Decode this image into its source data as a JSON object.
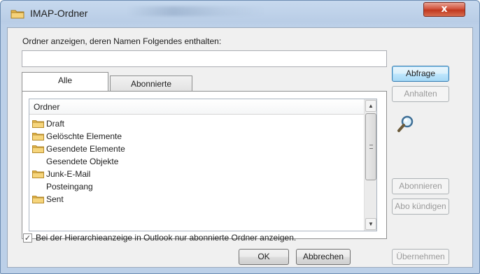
{
  "window": {
    "title": "IMAP-Ordner",
    "close_label": "x"
  },
  "filter": {
    "label": "Ordner anzeigen, deren Namen Folgendes enthalten:",
    "value": ""
  },
  "tabs": [
    {
      "label": "Alle",
      "active": true
    },
    {
      "label": "Abonnierte",
      "active": false
    }
  ],
  "folder_list": {
    "column_header": "Ordner",
    "rows": [
      {
        "name": "Draft",
        "icon": "folder-icon"
      },
      {
        "name": "Gelöschte Elemente",
        "icon": "folder-icon"
      },
      {
        "name": "Gesendete Elemente",
        "icon": "folder-icon"
      },
      {
        "name": "Gesendete Objekte",
        "icon": ""
      },
      {
        "name": "Junk-E-Mail",
        "icon": "folder-icon"
      },
      {
        "name": "Posteingang",
        "icon": ""
      },
      {
        "name": "Sent",
        "icon": "folder-icon"
      }
    ]
  },
  "checkbox": {
    "checked": true,
    "label": "Bei der Hierarchieanzeige in Outlook nur abonnierte Ordner anzeigen."
  },
  "buttons": {
    "query": "Abfrage",
    "stop": "Anhalten",
    "subscribe": "Abonnieren",
    "unsubscribe": "Abo kündigen",
    "ok": "OK",
    "cancel": "Abbrechen",
    "apply": "Übernehmen"
  },
  "colors": {
    "folder": "#e8b84a",
    "default_button_border": "#3c7fb1",
    "close_button": "#c0381e"
  }
}
